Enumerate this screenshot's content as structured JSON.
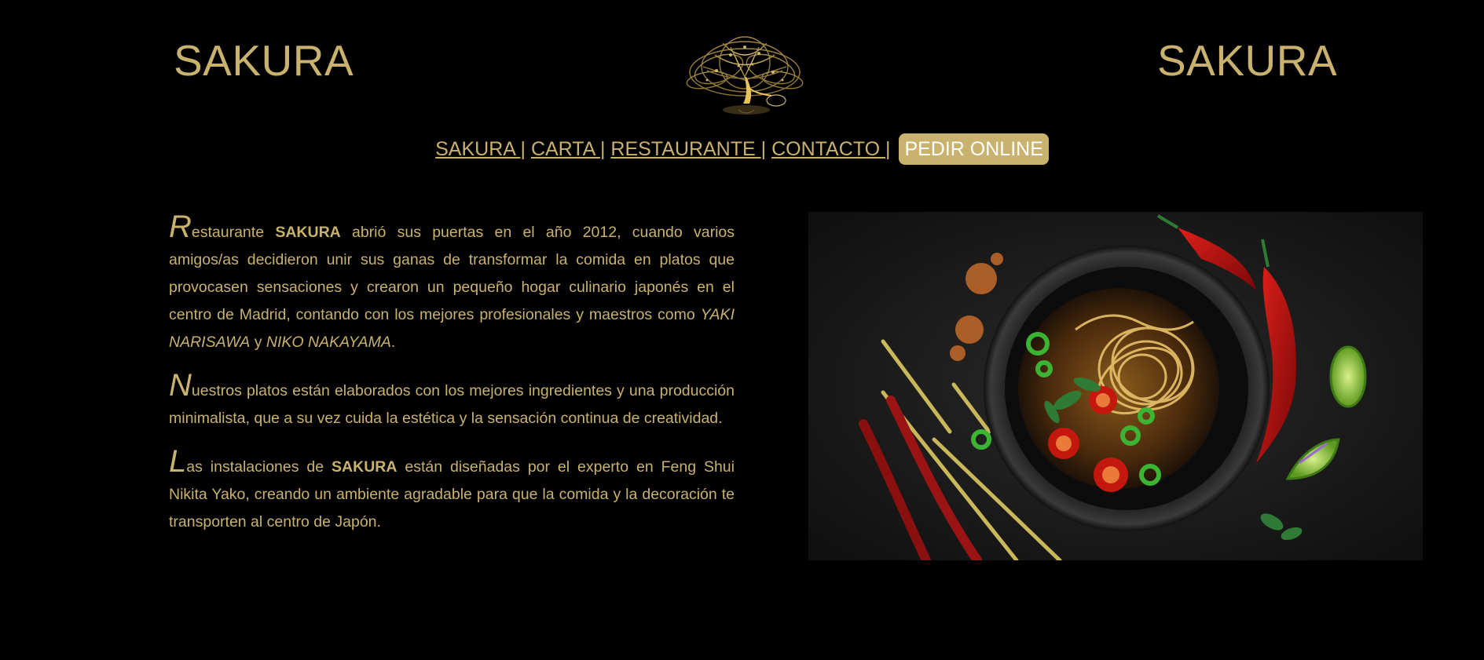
{
  "header": {
    "brand_left": "SAKURA",
    "brand_right": "SAKURA",
    "logo_icon": "golden-tree-logo"
  },
  "nav": {
    "items": [
      "SAKURA ",
      "CARTA ",
      "RESTAURANTE ",
      "CONTACTO "
    ],
    "separator": "|",
    "cta_label": "PEDIR ONLINE"
  },
  "content": {
    "p1": {
      "dropcap": "R",
      "text_a": "estaurante ",
      "bold": "SAKURA",
      "text_b": " abrió sus puertas en el año 2012, cuando varios amigos/as decidieron unir sus ganas de transformar la comida en platos que provocasen sensaciones y crearon un pequeño hogar culinario japonés en el centro de Madrid, contando con los mejores profesionales y maestros como ",
      "name1": "YAKI NARISAWA",
      "conj": " y ",
      "name2": "NIKO NAKAYAMA",
      "end": "."
    },
    "p2": {
      "dropcap": "N",
      "text": "uestros platos están elaborados con los mejores ingredientes y una producción minimalista, que a su vez cuida la estética y la sensación continua de creatividad."
    },
    "p3": {
      "dropcap": "L",
      "text_a": "as instalaciones de ",
      "bold": "SAKURA",
      "text_b": " están diseñadas por el experto en Feng Shui Nikita Yako, creando un ambiente agradable para que la comida y la decoración te transporten al centro de Japón."
    }
  },
  "hero_image": {
    "icon": "ramen-bowl-photo"
  },
  "colors": {
    "background": "#000000",
    "gold": "#c9b26e",
    "cta_text": "#ffffff"
  }
}
